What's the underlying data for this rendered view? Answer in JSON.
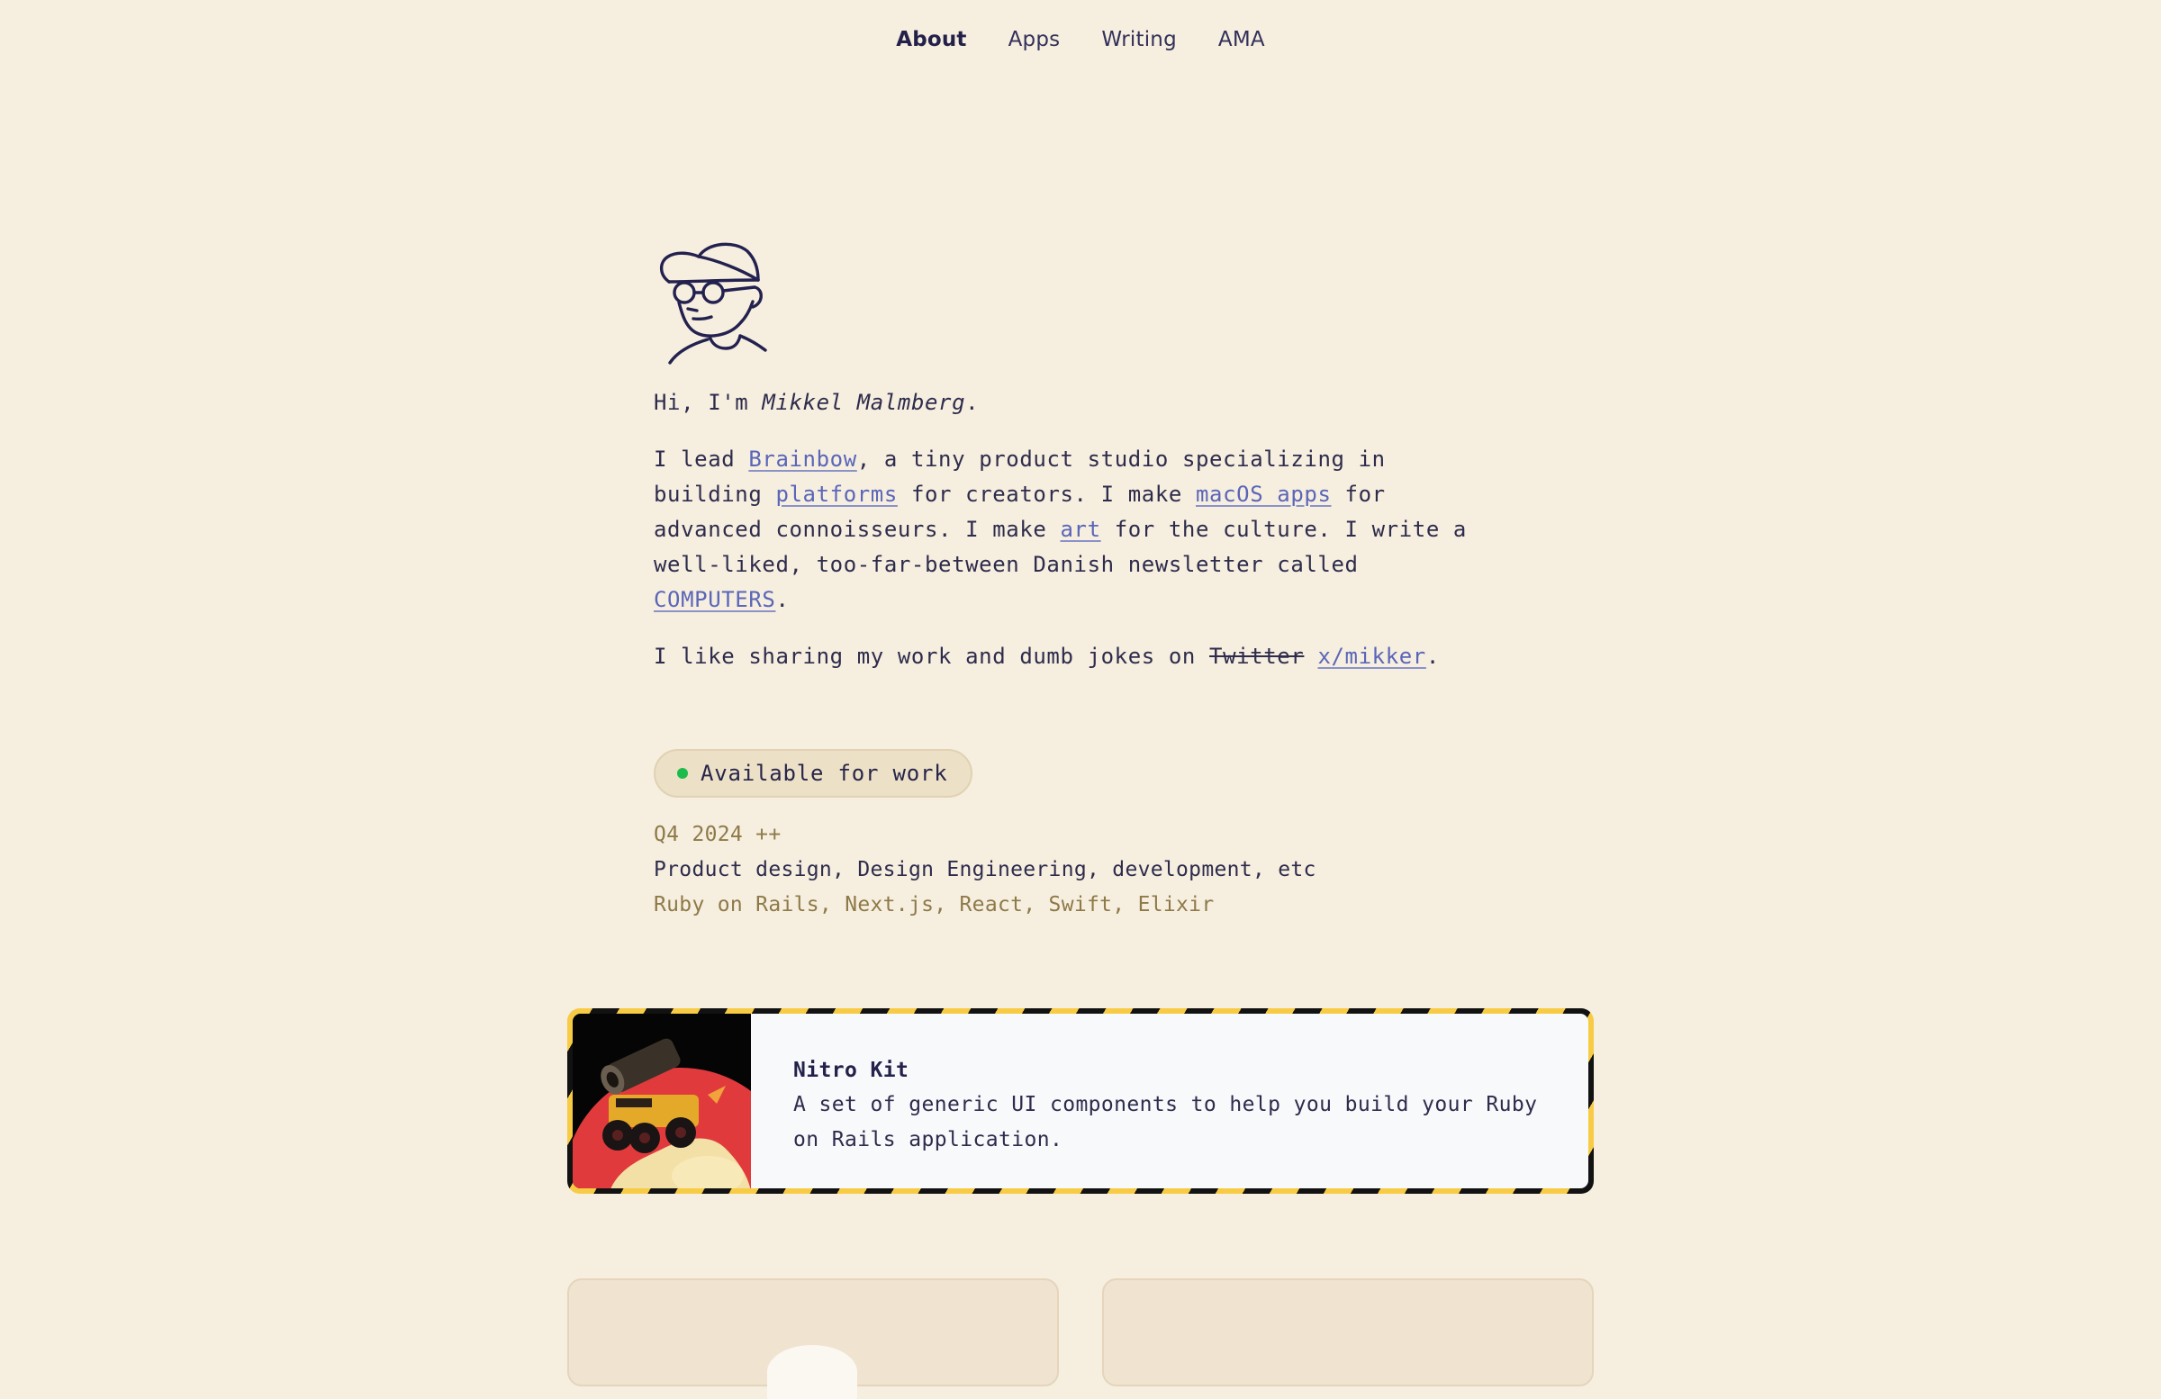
{
  "nav": {
    "items": [
      {
        "label": "About",
        "active": true
      },
      {
        "label": "Apps",
        "active": false
      },
      {
        "label": "Writing",
        "active": false
      },
      {
        "label": "AMA",
        "active": false
      }
    ]
  },
  "intro": {
    "greeting_prefix": "Hi, I'm ",
    "name": "Mikkel Malmberg",
    "greeting_suffix": ".",
    "p1": {
      "t1": "I lead ",
      "link_brainbow": "Brainbow",
      "t2": ", a tiny product studio specializing in building ",
      "link_platforms": "platforms",
      "t3": " for creators. I make ",
      "link_macos": "macOS apps",
      "t4": " for advanced connoisseurs. I make ",
      "link_art": "art",
      "t5": " for the culture. I write a well-liked, too-far-between Danish newsletter called ",
      "link_computers": "COMPUTERS",
      "t6": "."
    },
    "p2": {
      "t1": "I like sharing my work and dumb jokes on ",
      "struck": "Twitter",
      "t2": " ",
      "link_x": "x/mikker",
      "t3": "."
    }
  },
  "availability": {
    "badge_label": "Available for work",
    "status_color": "#1dbb4b",
    "when": "Q4 2024 ++",
    "what": "Product design, Design Engineering, development, etc",
    "stack": "Ruby on Rails, Next.js, React, Swift, Elixir"
  },
  "featured": {
    "title": "Nitro Kit",
    "description": "A set of generic UI components to help you build your Ruby on Rails application.",
    "image": "rocket-monster-truck-illustration"
  },
  "colors": {
    "background": "#f6eedf",
    "text": "#2e2c4c",
    "link": "#5a66b9",
    "muted": "#8e7a48",
    "stripe_yellow": "#f7cb44",
    "stripe_black": "#121212"
  }
}
